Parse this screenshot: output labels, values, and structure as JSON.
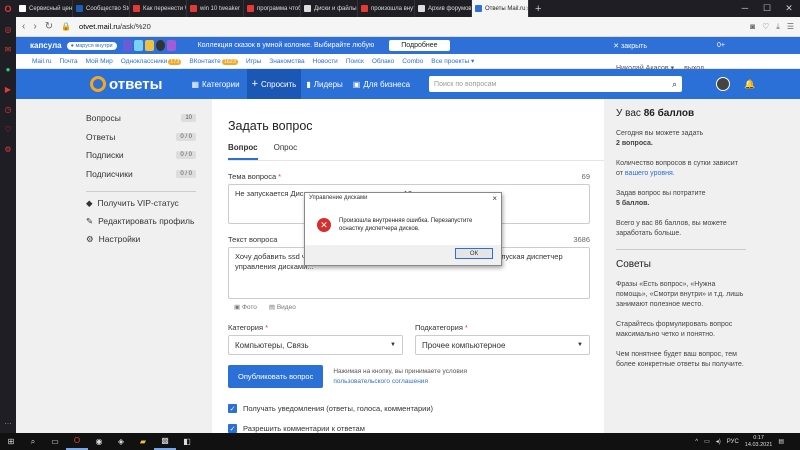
{
  "browser": {
    "tabs": [
      {
        "label": "Сервисный центр",
        "color": "#ffffff"
      },
      {
        "label": "Сообщество Steam",
        "color": "#1b5fb6"
      },
      {
        "label": "Как перенести Windows",
        "color": "#e53935"
      },
      {
        "label": "win 10 tweaker",
        "color": "#e53935"
      },
      {
        "label": "программа чтобы",
        "color": "#e53935"
      },
      {
        "label": "Диски и файлы",
        "color": "#dddddd"
      },
      {
        "label": "произошла внутр.",
        "color": "#e53935"
      },
      {
        "label": "Архив форумов",
        "color": "#dddddd"
      },
      {
        "label": "Ответы Mail.ru",
        "color": "#2e6fd8",
        "active": true
      }
    ],
    "url_domain": "otvet.mail.ru",
    "url_path": "/ask/%20"
  },
  "promo": {
    "logo": "капсула",
    "pill": "● маруся внутри",
    "text": "Коллекция сказок в умной колонке. Выбирайте любую",
    "more_button": "Подробнее",
    "close_label": "✕ закрыть",
    "counter": "0+"
  },
  "portal_nav": {
    "items": [
      "Mail.ru",
      "Почта",
      "Мой Мир",
      "Одноклассники",
      "ВКонтакте",
      "Игры",
      "Знакомства",
      "Новости",
      "Поиск",
      "Облако",
      "Combo",
      "Все проекты ▾"
    ],
    "ok_badge": "173",
    "vk_badge": "1623",
    "user": "Николай Акасов ▾",
    "logout": "выход"
  },
  "main_nav": {
    "brand": "ответы",
    "categories": "Категории",
    "ask": "Спросить",
    "leaders": "Лидеры",
    "business": "Для бизнеса",
    "search_placeholder": "Поиск по вопросам"
  },
  "left_menu": {
    "items": [
      {
        "label": "Вопросы",
        "count": "10"
      },
      {
        "label": "Ответы",
        "count": "0 / 0"
      },
      {
        "label": "Подписки",
        "count": "0 / 0"
      },
      {
        "label": "Подписчики",
        "count": "0 / 0"
      }
    ],
    "vip": "Получить VIP-статус",
    "edit_profile": "Редактировать профиль",
    "settings": "Настройки"
  },
  "form": {
    "title": "Задать вопрос",
    "tab_question": "Вопрос",
    "tab_poll": "Опрос",
    "theme_label": "Тема вопроса",
    "theme_count": "69",
    "theme_value": "Не запускается Диспетчер управления дисками 10",
    "body_label": "Текст вопроса",
    "body_count": "3686",
    "body_value": "Хочу добавить ssd через диспетчер управления дисками, но при попытке запуская диспетчер управления дисками...",
    "photo": "Фото",
    "video": "Видео",
    "category_label": "Категория",
    "category_value": "Компьютеры, Связь",
    "subcategory_label": "Подкатегория",
    "subcategory_value": "Прочее компьютерное",
    "publish": "Опубликовать вопрос",
    "terms_text": "Нажимая на кнопку, вы принимаете условия",
    "terms_link": "пользовательского соглашения",
    "notify": "Получать уведомления (ответы, голоса, комментарии)",
    "comments": "Разрешить комментарии к ответам"
  },
  "right_panel": {
    "balance_prefix": "У вас",
    "balance": "86 баллов",
    "today_text": "Сегодня вы можете задать",
    "today_value": "2 вопроса.",
    "limit_text": "Количество вопросов в сутки зависит от",
    "limit_link": "вашего уровня.",
    "cost_text": "Задав вопрос вы потратите",
    "cost_value": "5 баллов.",
    "total_text": "Всего у вас 86 баллов, вы можете заработать больше.",
    "tips_title": "Советы",
    "tip1": "Фразы «Есть вопрос», «Нужна помощь», «Смотри внутри» и т.д. лишь занимают полезное место.",
    "tip2": "Старайтесь формулировать вопрос максимально четко и понятно.",
    "tip3": "Чем понятнее будет ваш вопрос, тем более конкретные ответы вы получите."
  },
  "dialog": {
    "title": "Управление дисками",
    "message": "Произошла внутренняя ошибка. Перезапустите оснастку диспетчера дисков.",
    "ok": "ОК"
  },
  "taskbar": {
    "lang": "РУС",
    "time": "0:17",
    "date": "14.03.2021"
  },
  "colors": {
    "accent": "#2b70d6",
    "brand_orange": "#f5a623",
    "error": "#d32f2f"
  }
}
